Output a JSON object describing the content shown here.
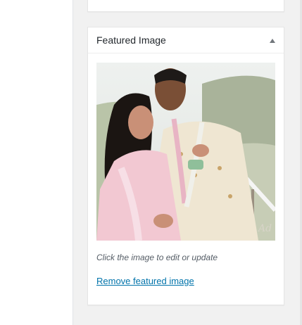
{
  "featured_image": {
    "title": "Featured Image",
    "image_alt": "Wedding couple photo",
    "hint": "Click the image to edit or update",
    "remove_label": "Remove featured image"
  },
  "colors": {
    "link": "#0073aa",
    "hint_text": "#555d66",
    "panel_border": "#e5e5e5"
  },
  "icons": [
    "chevron-up-icon"
  ]
}
